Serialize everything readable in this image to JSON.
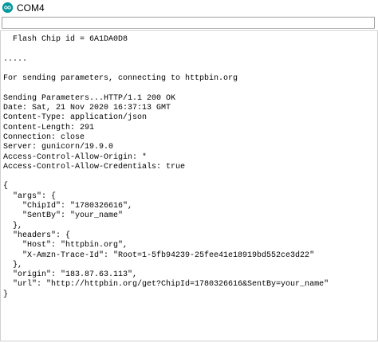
{
  "window": {
    "title": "COM4",
    "app_icon": "arduino-icon",
    "accent_color": "#00979d"
  },
  "send_bar": {
    "value": "",
    "placeholder": ""
  },
  "serial_output": {
    "lines": [
      "  Flash Chip id = 6A1DA0D8",
      "",
      ".....",
      "",
      "For sending parameters, connecting to httpbin.org",
      "",
      "Sending Parameters...HTTP/1.1 200 OK",
      "Date: Sat, 21 Nov 2020 16:37:13 GMT",
      "Content-Type: application/json",
      "Content-Length: 291",
      "Connection: close",
      "Server: gunicorn/19.9.0",
      "Access-Control-Allow-Origin: *",
      "Access-Control-Allow-Credentials: true",
      "",
      "{",
      "  \"args\": {",
      "    \"ChipId\": \"1780326616\",",
      "    \"SentBy\": \"your_name\"",
      "  },",
      "  \"headers\": {",
      "    \"Host\": \"httpbin.org\",",
      "    \"X-Amzn-Trace-Id\": \"Root=1-5fb94239-25fee41e18919bd552ce3d22\"",
      "  },",
      "  \"origin\": \"183.87.63.113\",",
      "  \"url\": \"http://httpbin.org/get?ChipId=1780326616&SentBy=your_name\"",
      "}"
    ]
  }
}
